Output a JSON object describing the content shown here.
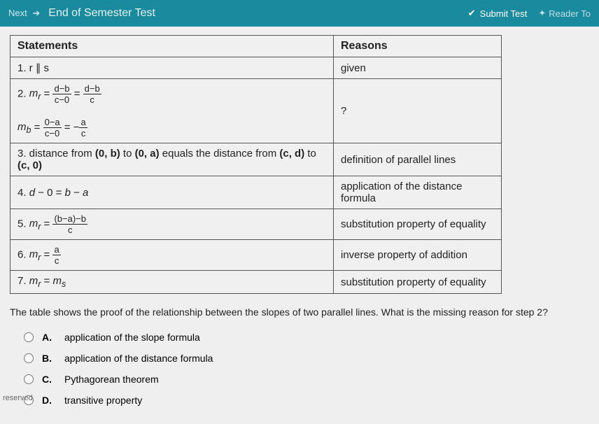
{
  "header": {
    "next_label": "Next",
    "title": "End of Semester Test",
    "submit_label": "Submit Test",
    "reader_label": "Reader To"
  },
  "table": {
    "headers": {
      "statements": "Statements",
      "reasons": "Reasons"
    },
    "rows": [
      {
        "statement_html": "1. r ∥ s",
        "reason": "given"
      },
      {
        "statement_html": "2. m_r = (d−b)/(c−0) = (d−b)/c ; m_b = (0−a)/(c−0) = −a/c",
        "reason": "?"
      },
      {
        "statement_html": "3. distance from (0, b) to (0, a) equals the distance from (c, d) to (c, 0)",
        "reason": "definition of parallel lines"
      },
      {
        "statement_html": "4. d − 0 = b − a",
        "reason": "application of the distance formula"
      },
      {
        "statement_html": "5. m_r = ((b−a)−b)/c",
        "reason": "substitution property of equality"
      },
      {
        "statement_html": "6. m_r = a/c",
        "reason": "inverse property of addition"
      },
      {
        "statement_html": "7. m_r = m_s",
        "reason": "substitution property of equality"
      }
    ]
  },
  "question": "The table shows the proof of the relationship between the slopes of two parallel lines. What is the missing reason for step 2?",
  "options": {
    "A": "application of the slope formula",
    "B": "application of the distance formula",
    "C": "Pythagorean theorem",
    "D": "transitive property"
  },
  "footer": "reserved"
}
